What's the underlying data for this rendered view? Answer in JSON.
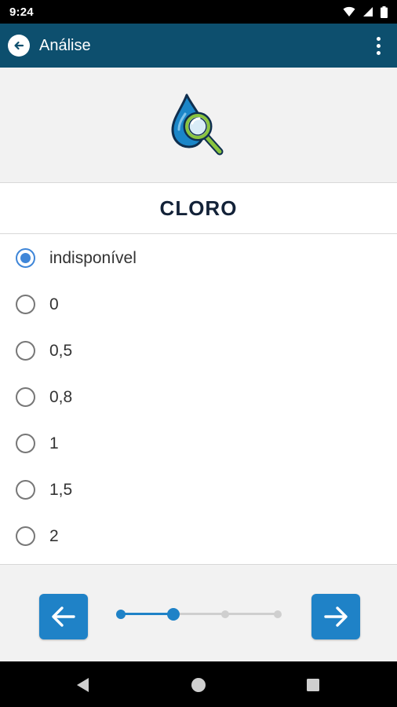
{
  "status_bar": {
    "time": "9:24"
  },
  "app_bar": {
    "title": "Análise"
  },
  "question": {
    "title": "CLORO"
  },
  "options": [
    {
      "label": "indisponível",
      "selected": true
    },
    {
      "label": "0",
      "selected": false
    },
    {
      "label": "0,5",
      "selected": false
    },
    {
      "label": "0,8",
      "selected": false
    },
    {
      "label": "1",
      "selected": false
    },
    {
      "label": "1,5",
      "selected": false
    },
    {
      "label": "2",
      "selected": false
    }
  ],
  "progress": {
    "current_step": 2,
    "total_steps": 4
  },
  "colors": {
    "app_bar": "#0d4f6e",
    "accent": "#1f82c7",
    "radio_selected": "#3f86d8",
    "title_text": "#132238"
  },
  "icons": {
    "back": "arrow-left-circle-icon",
    "menu": "more-vert-icon",
    "hero": "water-drop-magnifier-icon",
    "prev": "arrow-left-icon",
    "next": "arrow-right-icon"
  }
}
